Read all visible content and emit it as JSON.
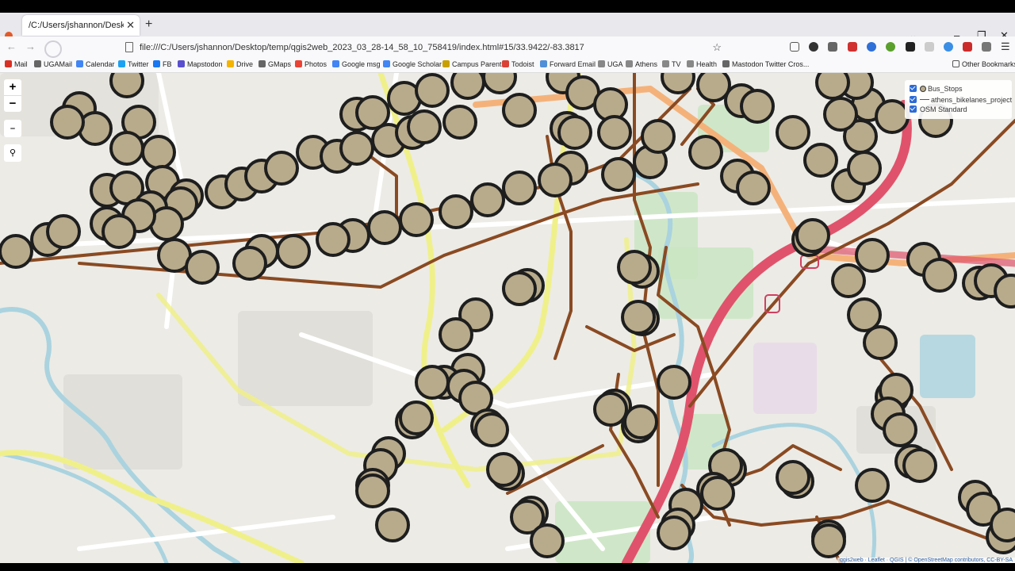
{
  "browser": {
    "tab": {
      "title": "/C:/Users/jshannon/Desktop/temp",
      "close": "✕"
    },
    "new_tab": "+",
    "window_controls": {
      "chevron": "⌄",
      "minimize": "–",
      "restore": "❐",
      "close": "✕"
    },
    "url": "file:///C:/Users/jshannon/Desktop/temp/qgis2web_2023_03_28-14_58_10_758419/index.html#15/33.9422/-83.3817",
    "bookmarks": [
      {
        "label": "Mail",
        "color": "#d93025"
      },
      {
        "label": "UGAMail",
        "color": "#666666"
      },
      {
        "label": "Calendar",
        "color": "#4285f4"
      },
      {
        "label": "Twitter",
        "color": "#1da1f2"
      },
      {
        "label": "FB",
        "color": "#1877f2"
      },
      {
        "label": "Mapstodon",
        "color": "#5a4fcf"
      },
      {
        "label": "Drive",
        "color": "#f4b400"
      },
      {
        "label": "GMaps",
        "color": "#666666"
      },
      {
        "label": "Photos",
        "color": "#ea4335"
      },
      {
        "label": "Google msg",
        "color": "#4285f4"
      },
      {
        "label": "Google Scholar",
        "color": "#4285f4"
      },
      {
        "label": "Campus Parent",
        "color": "#c8a000"
      },
      {
        "label": "Todoist",
        "color": "#db4035"
      },
      {
        "label": "Forward Email",
        "color": "#4f8fd8"
      },
      {
        "label": "UGA",
        "color": "#888888"
      },
      {
        "label": "Athens",
        "color": "#888888"
      },
      {
        "label": "TV",
        "color": "#888888"
      },
      {
        "label": "Health",
        "color": "#888888"
      },
      {
        "label": "Mastodon Twitter Cros...",
        "color": "#666666"
      }
    ],
    "other_bookmarks": "Other Bookmarks"
  },
  "map": {
    "zoom_in": "+",
    "zoom_out": "−",
    "layers": [
      {
        "label": "Bus_Stops",
        "checked": true
      },
      {
        "label": "athens_bikelanes_project",
        "checked": true
      },
      {
        "label": "OSM Standard",
        "checked": true
      }
    ],
    "attribution": "qgis2web · Leaflet · QGIS | © OpenStreetMap contributors, CC-BY-SA",
    "colors": {
      "stop_fill": "#b8ab8c",
      "stop_stroke": "#1e1e1e",
      "bikelane": "#8a4a22",
      "primary_road": "#e0526b",
      "secondary_road": "#f0f08a",
      "water": "#aad3df",
      "park": "#c8e6c0"
    }
  }
}
